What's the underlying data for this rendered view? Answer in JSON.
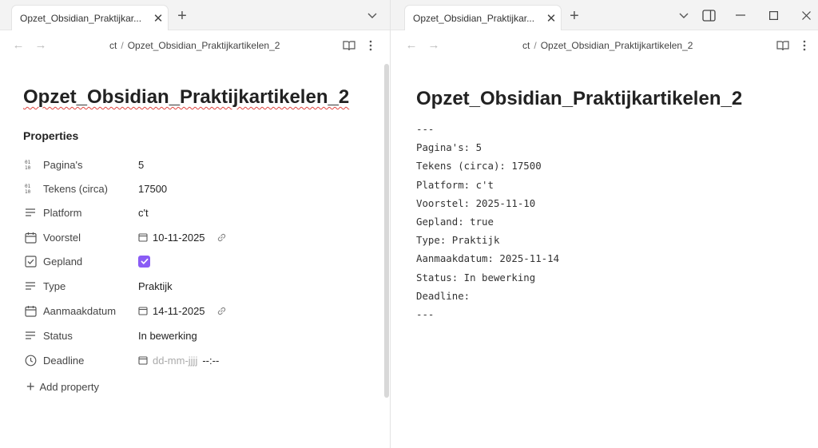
{
  "left": {
    "tab_title": "Opzet_Obsidian_Praktijkar...",
    "breadcrumb": {
      "folder": "ct",
      "separator": "/",
      "file": "Opzet_Obsidian_Praktijkartikelen_2"
    },
    "doc_title": "Opzet_Obsidian_Praktijkartikelen_2",
    "properties_heading": "Properties",
    "properties": [
      {
        "icon": "number-icon",
        "key": "Pagina's",
        "value": "5"
      },
      {
        "icon": "number-icon",
        "key": "Tekens (circa)",
        "value": "17500"
      },
      {
        "icon": "text-icon",
        "key": "Platform",
        "value": "c't"
      },
      {
        "icon": "calendar-icon",
        "key": "Voorstel",
        "value": "10-11-2025"
      },
      {
        "icon": "checkbox-icon",
        "key": "Gepland",
        "value": true
      },
      {
        "icon": "text-icon",
        "key": "Type",
        "value": "Praktijk"
      },
      {
        "icon": "calendar-icon",
        "key": "Aanmaakdatum",
        "value": "14-11-2025"
      },
      {
        "icon": "text-icon",
        "key": "Status",
        "value": "In bewerking"
      },
      {
        "icon": "clock-icon",
        "key": "Deadline",
        "placeholder_date": "dd-mm-jjjj",
        "placeholder_time": "--:--"
      }
    ],
    "add_property_label": "Add property"
  },
  "right": {
    "tab_title": "Opzet_Obsidian_Praktijkar...",
    "breadcrumb": {
      "folder": "ct",
      "separator": "/",
      "file": "Opzet_Obsidian_Praktijkartikelen_2"
    },
    "doc_title": "Opzet_Obsidian_Praktijkartikelen_2",
    "source_lines": [
      "---",
      "Pagina's: 5",
      "Tekens (circa): 17500",
      "Platform: c't",
      "Voorstel: 2025-11-10",
      "Gepland: true",
      "Type: Praktijk",
      "Aanmaakdatum: 2025-11-14",
      "Status: In bewerking",
      "Deadline:",
      "---"
    ]
  },
  "colors": {
    "accent": "#8a5cf5",
    "spellcheck": "#e0443f"
  }
}
